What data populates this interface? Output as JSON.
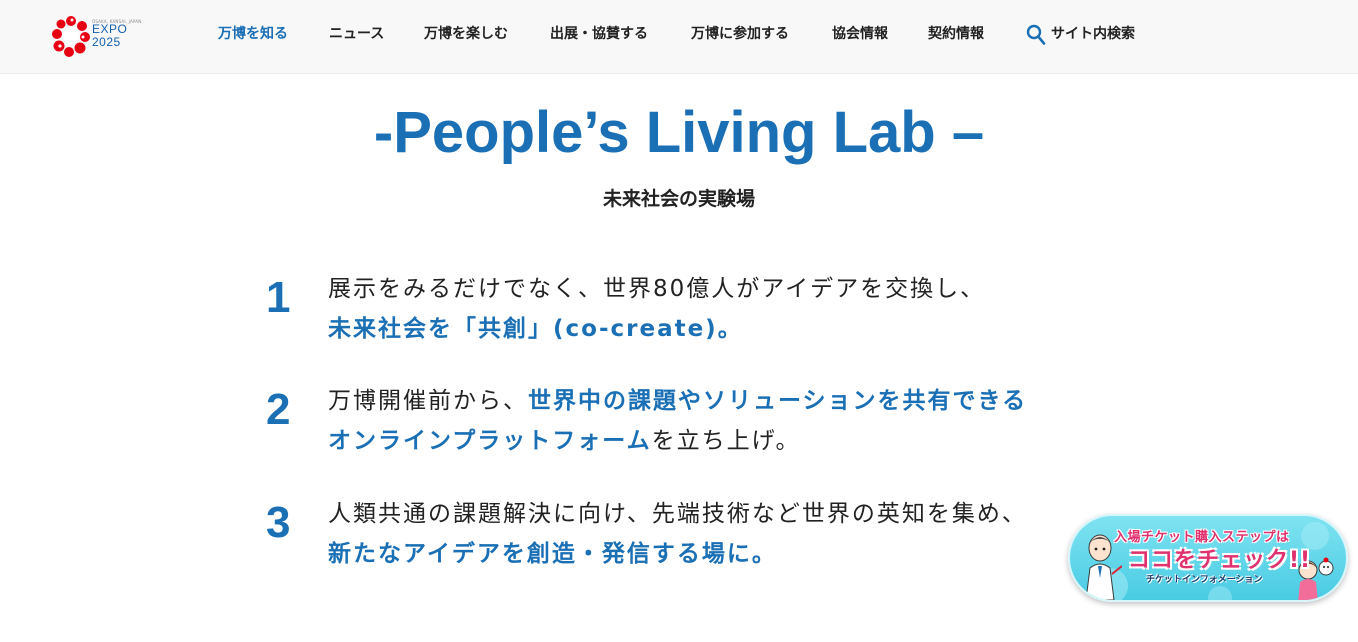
{
  "header": {
    "logo": {
      "small_text": "OSAKA, KANSAI, JAPAN",
      "brand": "EXPO",
      "year": "2025",
      "accent_color": "#e60012",
      "brand_color": "#1360ad"
    },
    "nav": [
      {
        "label": "万博を知る",
        "active": true
      },
      {
        "label": "ニュース",
        "active": false
      },
      {
        "label": "万博を楽しむ",
        "active": false
      },
      {
        "label": "出展・協賛する",
        "active": false
      },
      {
        "label": "万博に参加する",
        "active": false
      },
      {
        "label": "協会情報",
        "active": false
      },
      {
        "label": "契約情報",
        "active": false
      }
    ],
    "search": {
      "label": "サイト内検索",
      "icon": "search-icon"
    }
  },
  "hero": {
    "title": "-People’s Living Lab –",
    "subtitle": "未来社会の実験場"
  },
  "points": [
    {
      "number": "1",
      "line1": [
        {
          "text": "展示をみるだけでなく、世界80億人がアイデアを交換し、",
          "highlight": false
        }
      ],
      "line2": [
        {
          "text": "未来社会を「共創」(co-create)",
          "highlight": true
        },
        {
          "text": "。",
          "highlight": false
        }
      ]
    },
    {
      "number": "2",
      "line1": [
        {
          "text": "万博開催前から、",
          "highlight": false
        },
        {
          "text": "世界中の課題やソリューションを共有できる",
          "highlight": true
        }
      ],
      "line2": [
        {
          "text": "オンラインプラットフォーム",
          "highlight": true
        },
        {
          "text": "を立ち上げ。",
          "highlight": false
        }
      ]
    },
    {
      "number": "3",
      "line1": [
        {
          "text": "人類共通の課題解決に向け、先端技術など世界の英知を集め、",
          "highlight": false
        }
      ],
      "line2": [
        {
          "text": "新たなアイデアを創造・発信する場に",
          "highlight": true
        },
        {
          "text": "。",
          "highlight": false
        }
      ]
    }
  ],
  "banner": {
    "top": "入場チケット購入ステップは",
    "main": "ココをチェック!!",
    "sub": "チケットインフォメーション"
  },
  "colors": {
    "primary": "#1a6fb5",
    "text": "#222222",
    "header_bg": "#f8f8f8",
    "banner_bg": "#49cbe3",
    "banner_text": "#e0306e"
  }
}
